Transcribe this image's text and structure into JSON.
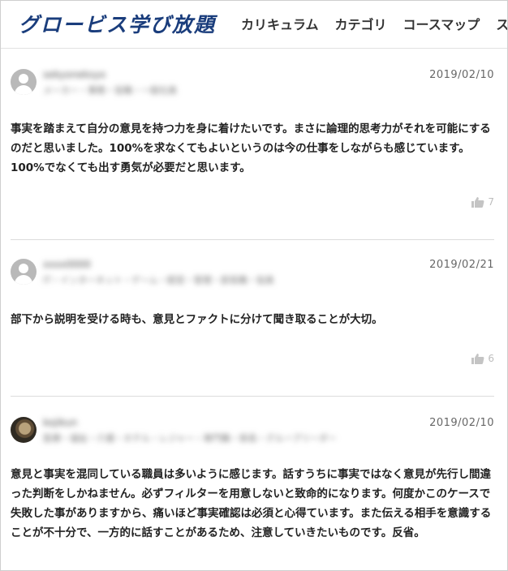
{
  "header": {
    "logo": "グロービス学び放題",
    "nav": [
      "カリキュラム",
      "カテゴリ",
      "コースマップ",
      "ス"
    ]
  },
  "comments": [
    {
      "username": "sekyoneksyo",
      "meta": "メーカー・事務・役職・一般社員",
      "date": "2019/02/10",
      "text": "事実を踏まえて自分の意見を持つ力を身に着けたいです。まさに論理的思考力がそれを可能にするのだと思いました。100%を求なくてもよいというのは今の仕事をしながらも感じています。100%でなくても出す勇気が必要だと思います。",
      "likes": "7",
      "avatar": "default"
    },
    {
      "username": "xxxx0000",
      "meta": "IT・インターネット・ゲーム・経営・管理・部長職・役員",
      "date": "2019/02/21",
      "text": "部下から説明を受ける時も、意見とファクトに分けて聞き取ることが大切。",
      "likes": "6",
      "avatar": "default"
    },
    {
      "username": "kojikun",
      "meta": "医療・福祉・介護・ホテル・レジャー・専門職・係長・グループリーダー",
      "date": "2019/02/10",
      "text": "意見と事実を混同している職員は多いように感じます。話すうちに事実ではなく意見が先行し間違った判断をしかねません。必ずフィルターを用意しないと致命的になります。何度かこのケースで失敗した事がありますから、痛いほど事実確認は必須と心得ています。また伝える相手を意識することが不十分で、一方的に話すことがあるため、注意していきたいものです。反省。",
      "likes": "",
      "avatar": "photo"
    }
  ]
}
